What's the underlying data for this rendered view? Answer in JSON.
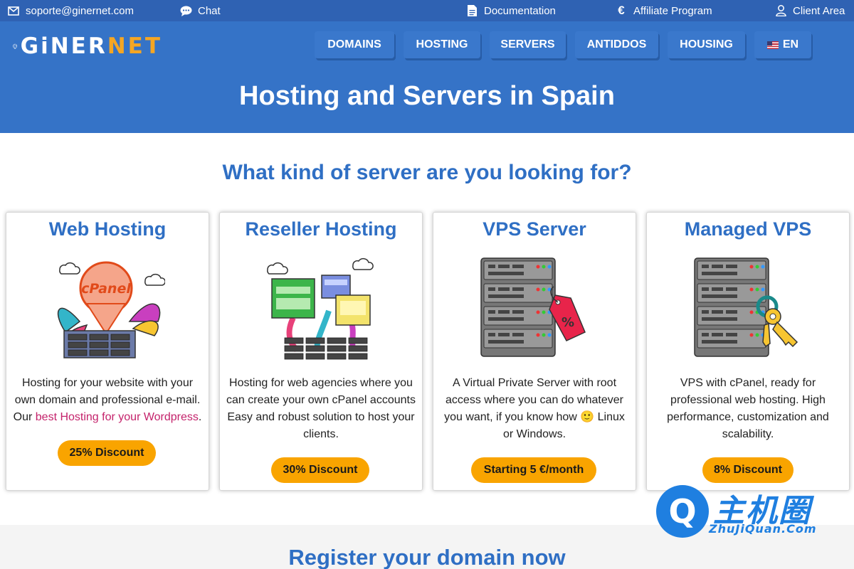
{
  "topbar": {
    "email": "soporte@ginernet.com",
    "chat": "Chat",
    "documentation": "Documentation",
    "affiliate": "Affiliate Program",
    "client_area": "Client Area"
  },
  "header": {
    "logo_white": "GiNER",
    "logo_orange": "NET",
    "nav": [
      "DOMAINS",
      "HOSTING",
      "SERVERS",
      "ANTIDDOS",
      "HOUSING",
      "EN"
    ],
    "hero_title": "Hosting and Servers in Spain"
  },
  "main": {
    "section_title": "What kind of server are you looking for?",
    "cards": [
      {
        "title": "Web Hosting",
        "desc_before": "Hosting for your website with your own domain and professional e-mail. Our ",
        "desc_link": "best Hosting for your Wordpress",
        "desc_after": ".",
        "button": "25% Discount"
      },
      {
        "title": "Reseller Hosting",
        "desc": "Hosting for web agencies where you can create your own cPanel accounts Easy and robust solution to host your clients.",
        "button": "30% Discount"
      },
      {
        "title": "VPS Server",
        "desc": "A Virtual Private Server with root access where you can do whatever you want, if you know how 🙂 Linux or Windows.",
        "button": "Starting 5 €/month"
      },
      {
        "title": "Managed VPS",
        "desc": "VPS with cPanel, ready for professional web hosting. High performance, customization and scalability.",
        "button": "8% Discount"
      }
    ],
    "cpanel_label": "cPanel",
    "tag_label": "%",
    "bottom_title": "Register your domain now"
  },
  "watermark": {
    "letter": "Q",
    "cn": "主机圈",
    "en": "ZhuJiQuan.Com"
  },
  "colors": {
    "topbar": "#2f62b3",
    "header": "#3573c7",
    "title_blue": "#2f6fc4",
    "button_orange": "#f9a400",
    "link_pink": "#c4226b"
  }
}
